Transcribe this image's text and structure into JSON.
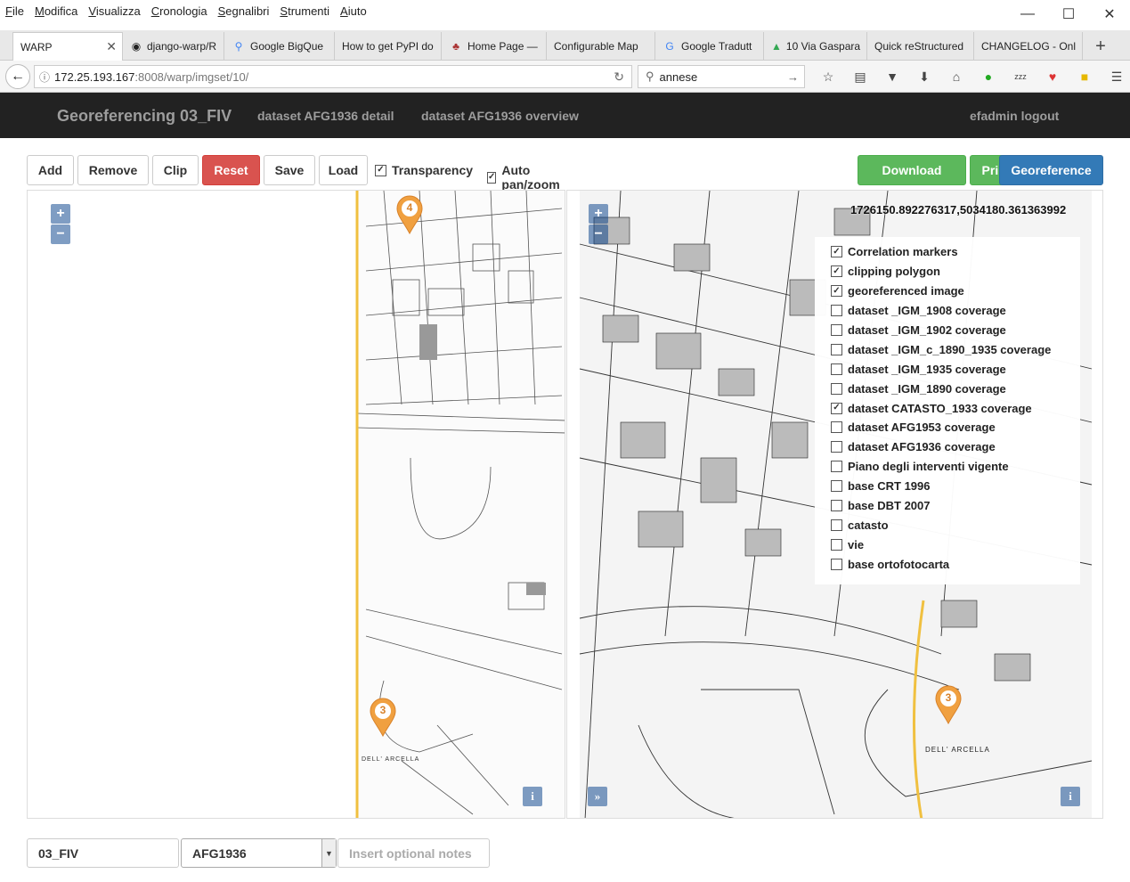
{
  "browser": {
    "menu": [
      "File",
      "Modifica",
      "Visualizza",
      "Cronologia",
      "Segnalibri",
      "Strumenti",
      "Aiuto"
    ],
    "tabs": [
      {
        "label": "WARP",
        "icon": "",
        "active": true
      },
      {
        "label": "django-warp/R",
        "icon": "github-icon"
      },
      {
        "label": "Google BigQue",
        "icon": "search-icon"
      },
      {
        "label": "How to get PyPI do",
        "icon": ""
      },
      {
        "label": "Home Page —",
        "icon": "page-icon"
      },
      {
        "label": "Configurable Map",
        "icon": ""
      },
      {
        "label": "Google Tradutt",
        "icon": "translate-icon"
      },
      {
        "label": "10 Via Gaspara",
        "icon": "maps-icon"
      },
      {
        "label": "Quick reStructured",
        "icon": ""
      },
      {
        "label": "CHANGELOG - Onl",
        "icon": ""
      }
    ],
    "url_host": "172.25.193.167",
    "url_rest": ":8008/warp/imgset/10/",
    "search_value": "annese"
  },
  "app": {
    "brand": "Georeferencing 03_FIV",
    "nav_links": [
      "dataset AFG1936 detail",
      "dataset AFG1936 overview"
    ],
    "user_link": "efadmin logout"
  },
  "toolbar": {
    "add": "Add",
    "remove": "Remove",
    "clip": "Clip",
    "reset": "Reset",
    "save": "Save",
    "load": "Load",
    "transparency": "Transparency",
    "auto_pan": "Auto pan/zoom",
    "download": "Download",
    "print": "Print",
    "georeference": "Georeference",
    "colors": {
      "danger": "#d9534f",
      "success": "#5cb85c",
      "primary": "#337ab7"
    }
  },
  "left_map": {
    "markers": [
      "4",
      "3"
    ],
    "zoom_in": "+",
    "zoom_out": "−",
    "info": "i"
  },
  "right_map": {
    "coordinates": "1726150.892276317,5034180.361363992",
    "zoom_in": "+",
    "zoom_out": "−",
    "info": "i",
    "expand": "»",
    "markers": [
      "3"
    ],
    "layers": [
      {
        "label": "Correlation markers",
        "checked": true
      },
      {
        "label": "clipping polygon",
        "checked": true
      },
      {
        "label": "georeferenced image",
        "checked": true
      },
      {
        "label": "dataset _IGM_1908 coverage",
        "checked": false
      },
      {
        "label": "dataset _IGM_1902 coverage",
        "checked": false
      },
      {
        "label": "dataset _IGM_c_1890_1935 coverage",
        "checked": false
      },
      {
        "label": "dataset _IGM_1935 coverage",
        "checked": false
      },
      {
        "label": "dataset _IGM_1890 coverage",
        "checked": false
      },
      {
        "label": "dataset CATASTO_1933 coverage",
        "checked": true
      },
      {
        "label": "dataset AFG1953 coverage",
        "checked": false
      },
      {
        "label": "dataset AFG1936 coverage",
        "checked": false
      },
      {
        "label": "Piano degli interventi vigente",
        "checked": false
      },
      {
        "label": "base CRT 1996",
        "checked": false
      },
      {
        "label": "base DBT 2007",
        "checked": false
      },
      {
        "label": "catasto",
        "checked": false
      },
      {
        "label": "vie",
        "checked": false
      },
      {
        "label": "base ortofotocarta",
        "checked": false
      }
    ]
  },
  "bottom": {
    "imgset_name": "03_FIV",
    "dataset_select": "AFG1936",
    "notes_placeholder": "Insert optional notes"
  },
  "map_labels": {
    "left_place": "DELL' ARCELLA",
    "right_place": "DELL' ARCELLA"
  }
}
